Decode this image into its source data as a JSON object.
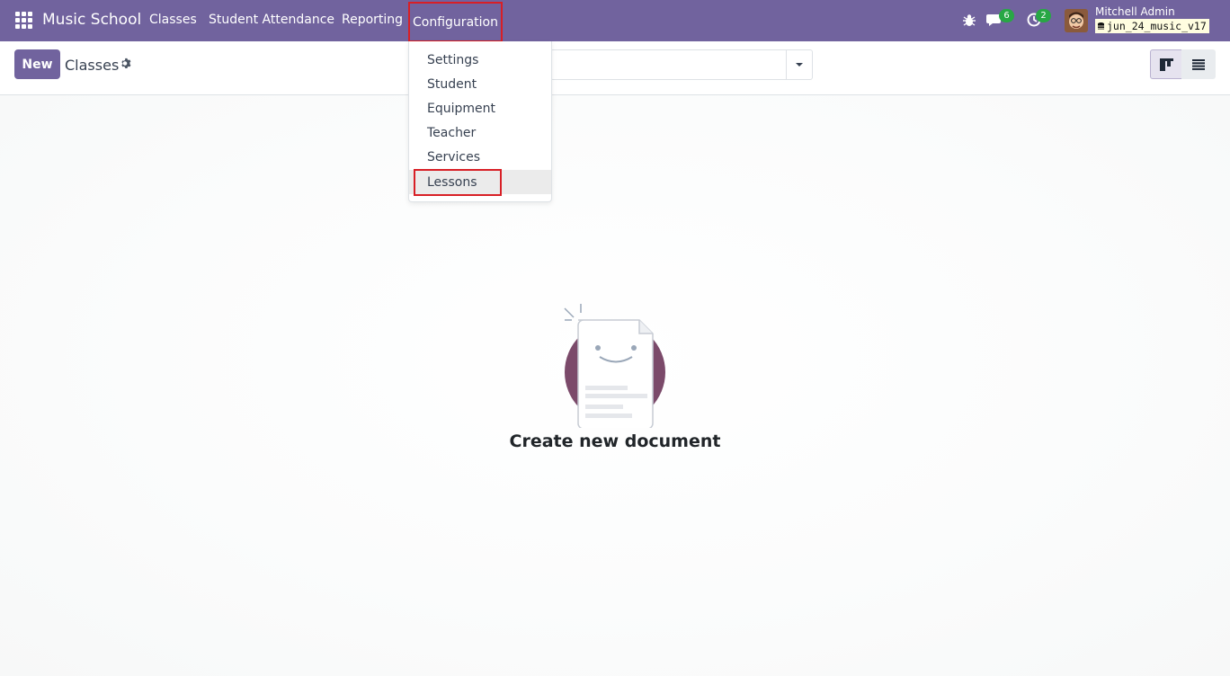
{
  "app": {
    "name": "Music School"
  },
  "navbar": {
    "menus": [
      "Classes",
      "Student Attendance",
      "Reporting"
    ],
    "active_menu": "Configuration",
    "messages_count": "6",
    "activities_count": "2",
    "user_name": "Mitchell Admin",
    "database": "jun_24_music_v17"
  },
  "control_panel": {
    "new_label": "New",
    "title": "Classes"
  },
  "dropdown": {
    "items": [
      "Settings",
      "Student",
      "Equipment",
      "Teacher",
      "Services",
      "Lessons"
    ],
    "highlighted": "Lessons"
  },
  "empty_state": {
    "title": "Create new document"
  },
  "colors": {
    "brand": "#71639e",
    "highlight": "#d81f26",
    "badge": "#28a745"
  }
}
